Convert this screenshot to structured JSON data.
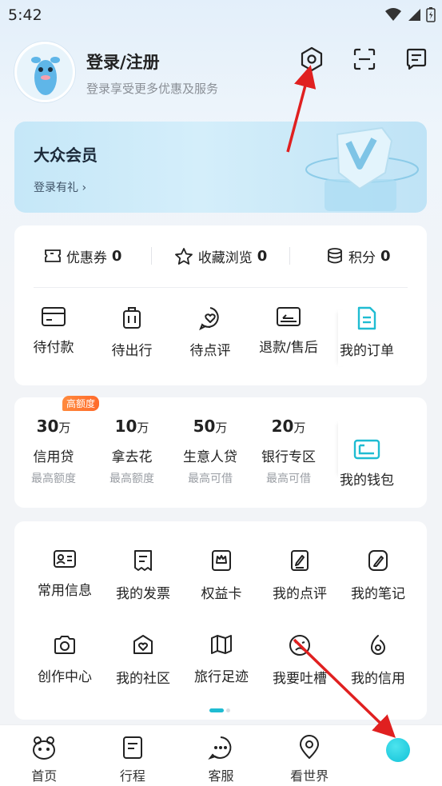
{
  "status": {
    "time": "5:42",
    "icons": [
      "wifi-icon",
      "signal-icon",
      "battery-icon"
    ]
  },
  "header": {
    "title": "登录/注册",
    "subtitle": "登录享受更多优惠及服务",
    "icons": [
      "settings-icon",
      "scan-icon",
      "message-icon"
    ]
  },
  "member": {
    "title": "大众会员",
    "link": "登录有礼 ›"
  },
  "stats": [
    {
      "label": "优惠券",
      "value": "0",
      "icon": "coupon-icon"
    },
    {
      "label": "收藏浏览",
      "value": "0",
      "icon": "star-icon"
    },
    {
      "label": "积分",
      "value": "0",
      "icon": "points-icon"
    }
  ],
  "orders": [
    {
      "label": "待付款",
      "icon": "card-icon"
    },
    {
      "label": "待出行",
      "icon": "luggage-icon"
    },
    {
      "label": "待点评",
      "icon": "review-icon"
    },
    {
      "label": "退款/售后",
      "icon": "refund-icon"
    },
    {
      "label": "我的订单",
      "icon": "order-icon"
    }
  ],
  "finance": {
    "badge": "高额度",
    "items": [
      {
        "amount": "30",
        "unit": "万",
        "name": "信用贷",
        "note": "最高额度"
      },
      {
        "amount": "10",
        "unit": "万",
        "name": "拿去花",
        "note": "最高额度"
      },
      {
        "amount": "50",
        "unit": "万",
        "name": "生意人贷",
        "note": "最高可借"
      },
      {
        "amount": "20",
        "unit": "万",
        "name": "银行专区",
        "note": "最高可借"
      }
    ],
    "wallet": {
      "label": "我的钱包",
      "icon": "wallet-icon"
    }
  },
  "services": {
    "row1": [
      {
        "label": "常用信息",
        "icon": "id-card-icon"
      },
      {
        "label": "我的发票",
        "icon": "invoice-icon"
      },
      {
        "label": "权益卡",
        "icon": "benefit-card-icon"
      },
      {
        "label": "我的点评",
        "icon": "edit-review-icon"
      },
      {
        "label": "我的笔记",
        "icon": "note-icon"
      }
    ],
    "row2": [
      {
        "label": "创作中心",
        "icon": "camera-icon"
      },
      {
        "label": "我的社区",
        "icon": "community-icon"
      },
      {
        "label": "旅行足迹",
        "icon": "map-icon"
      },
      {
        "label": "我要吐槽",
        "icon": "complain-icon"
      },
      {
        "label": "我的信用",
        "icon": "credit-icon"
      }
    ]
  },
  "tabs": [
    {
      "label": "首页",
      "icon": "home-icon"
    },
    {
      "label": "行程",
      "icon": "trip-icon"
    },
    {
      "label": "客服",
      "icon": "chat-icon"
    },
    {
      "label": "看世界",
      "icon": "location-icon"
    },
    {
      "label": "",
      "icon": "my-dot-icon"
    }
  ],
  "colors": {
    "accent": "#1fbcd2",
    "badge": "#ff7a33",
    "arrow": "#e02020"
  }
}
